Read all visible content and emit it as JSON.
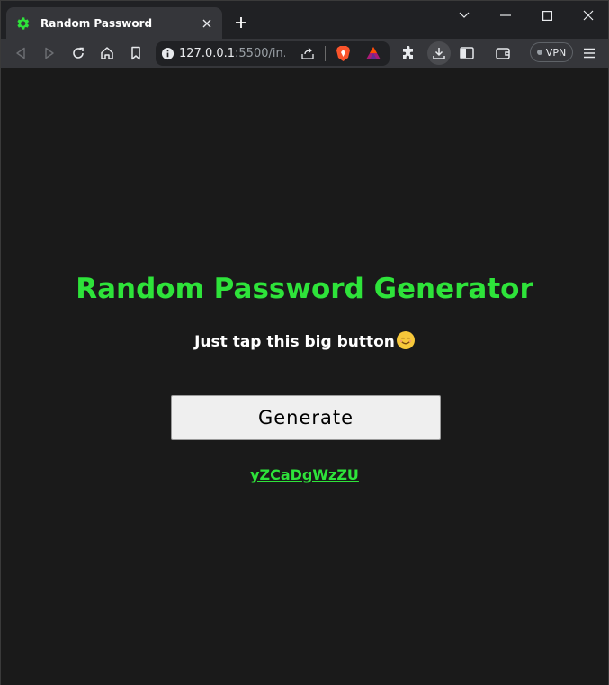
{
  "browser": {
    "tab_title": "Random Password",
    "url_host": "127.0.0.1",
    "url_path": ":5500/in...",
    "vpn_label": "VPN",
    "accent": "#2ee33a"
  },
  "page": {
    "heading": "Random Password Generator",
    "subheading": "Just tap this big button",
    "generate_label": "Generate",
    "password": "yZCaDgWzZU"
  },
  "icons": [
    "gear-icon",
    "close-icon",
    "plus-icon",
    "minimize-icon",
    "maximize-icon",
    "back-icon",
    "forward-icon",
    "reload-icon",
    "home-icon",
    "bookmark-icon",
    "info-icon",
    "share-icon",
    "brave-shield-icon",
    "brave-rewards-icon",
    "extensions-icon",
    "download-icon",
    "sidebar-icon",
    "wallet-icon",
    "menu-icon",
    "smile-emoji-icon"
  ]
}
